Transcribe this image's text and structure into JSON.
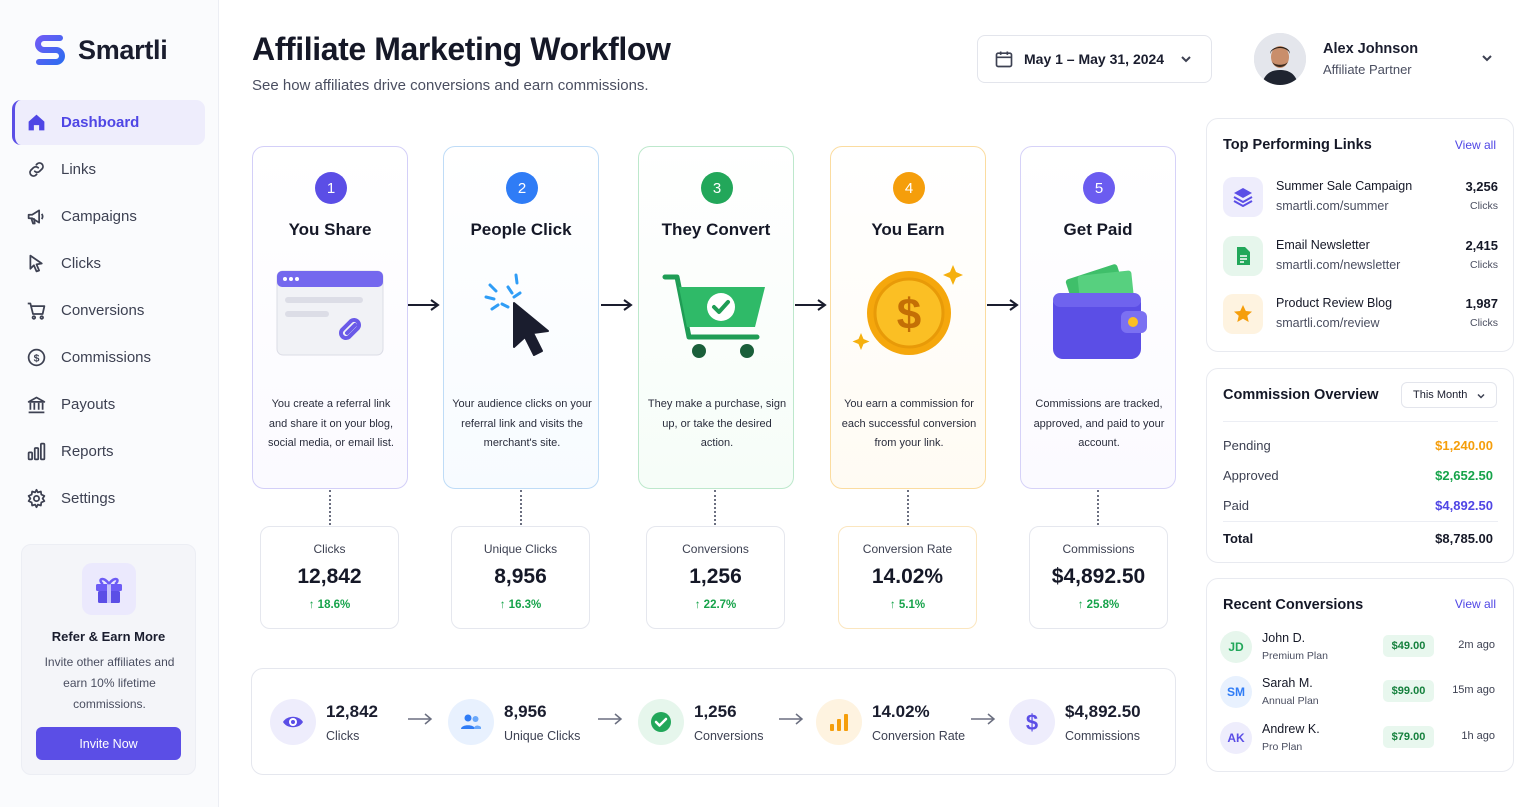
{
  "app": {
    "name": "Smartli"
  },
  "sidebar": {
    "items": [
      {
        "label": "Dashboard",
        "icon": "home-icon"
      },
      {
        "label": "Links",
        "icon": "link-icon"
      },
      {
        "label": "Campaigns",
        "icon": "megaphone-icon"
      },
      {
        "label": "Clicks",
        "icon": "cursor-icon"
      },
      {
        "label": "Conversions",
        "icon": "cart-icon"
      },
      {
        "label": "Commissions",
        "icon": "dollar-circle-icon"
      },
      {
        "label": "Payouts",
        "icon": "bank-icon"
      },
      {
        "label": "Reports",
        "icon": "bar-chart-icon"
      },
      {
        "label": "Settings",
        "icon": "gear-icon"
      }
    ],
    "promo": {
      "title": "Refer & Earn More",
      "text": "Invite other affiliates and earn 10% lifetime commissions.",
      "button": "Invite Now"
    }
  },
  "header": {
    "title": "Affiliate Marketing Workflow",
    "subtitle": "See how affiliates drive conversions and earn commissions.",
    "date_range": "May 1 – May 31, 2024",
    "user": {
      "name": "Alex Johnson",
      "role": "Affiliate Partner"
    }
  },
  "steps": [
    {
      "num": "1",
      "title": "You Share",
      "desc": "You create a referral link and share it on your blog, social media, or email list.",
      "color": "#5b4ee6"
    },
    {
      "num": "2",
      "title": "People Click",
      "desc": "Your audience clicks on your referral link and visits the merchant's site.",
      "color": "#2f7cf6"
    },
    {
      "num": "3",
      "title": "They Convert",
      "desc": "They make a purchase, sign up, or take the desired action.",
      "color": "#22a75a"
    },
    {
      "num": "4",
      "title": "You Earn",
      "desc": "You earn a commission for each successful conversion from your link.",
      "color": "#f59e0b"
    },
    {
      "num": "5",
      "title": "Get Paid",
      "desc": "Commissions are tracked, approved, and paid to your account.",
      "color": "#6b5cf0"
    }
  ],
  "stats": [
    {
      "label": "Clicks",
      "value": "12,842",
      "change": "18.6%"
    },
    {
      "label": "Unique Clicks",
      "value": "8,956",
      "change": "16.3%"
    },
    {
      "label": "Conversions",
      "value": "1,256",
      "change": "22.7%"
    },
    {
      "label": "Conversion Rate",
      "value": "14.02%",
      "change": "5.1%"
    },
    {
      "label": "Commissions",
      "value": "$4,892.50",
      "change": "25.8%"
    }
  ],
  "summary": [
    {
      "value": "12,842",
      "label": "Clicks",
      "icon": "eye-icon"
    },
    {
      "value": "8,956",
      "label": "Unique Clicks",
      "icon": "users-icon"
    },
    {
      "value": "1,256",
      "label": "Conversions",
      "icon": "check-circle-icon"
    },
    {
      "value": "14.02%",
      "label": "Conversion Rate",
      "icon": "bar-chart-icon"
    },
    {
      "value": "$4,892.50",
      "label": "Commissions",
      "icon": "dollar-icon"
    }
  ],
  "top_links": {
    "title": "Top Performing Links",
    "view_all": "View all",
    "clicks_label": "Clicks",
    "items": [
      {
        "name": "Summer Sale Campaign",
        "url": "smartli.com/summer",
        "count": "3,256",
        "icon": "layers-icon"
      },
      {
        "name": "Email Newsletter",
        "url": "smartli.com/newsletter",
        "count": "2,415",
        "icon": "document-icon"
      },
      {
        "name": "Product Review Blog",
        "url": "smartli.com/review",
        "count": "1,987",
        "icon": "star-icon"
      }
    ]
  },
  "commission_overview": {
    "title": "Commission Overview",
    "period": "This Month",
    "rows": [
      {
        "label": "Pending",
        "value": "$1,240.00",
        "color": "#f59e0b"
      },
      {
        "label": "Approved",
        "value": "$2,652.50",
        "color": "#16a34a"
      },
      {
        "label": "Paid",
        "value": "$4,892.50",
        "color": "#4f46e5"
      }
    ],
    "total_label": "Total",
    "total_value": "$8,785.00"
  },
  "recent_conversions": {
    "title": "Recent Conversions",
    "view_all": "View all",
    "items": [
      {
        "initials": "JD",
        "name": "John D.",
        "plan": "Premium Plan",
        "amount": "$49.00",
        "time": "2m ago"
      },
      {
        "initials": "SM",
        "name": "Sarah M.",
        "plan": "Annual Plan",
        "amount": "$99.00",
        "time": "15m ago"
      },
      {
        "initials": "AK",
        "name": "Andrew K.",
        "plan": "Pro Plan",
        "amount": "$79.00",
        "time": "1h ago"
      }
    ]
  }
}
